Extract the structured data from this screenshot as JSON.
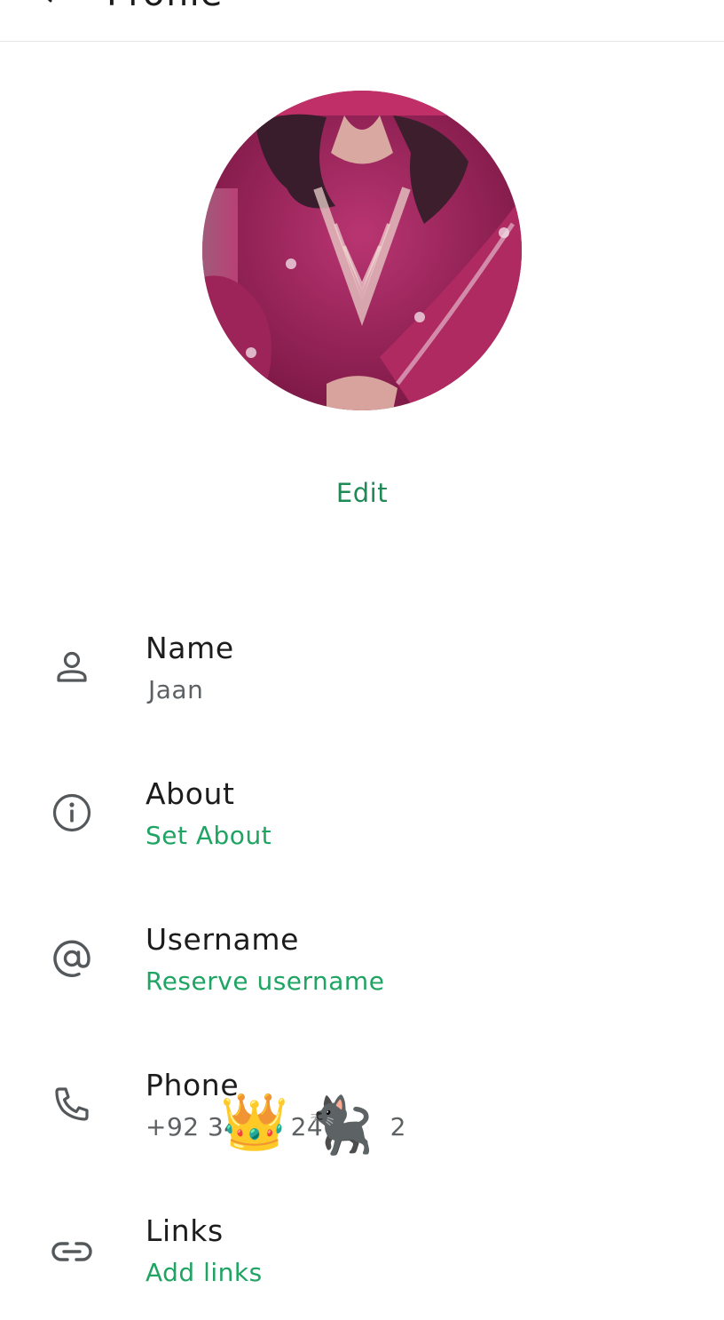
{
  "header": {
    "title": "Profile"
  },
  "profile": {
    "edit_label": "Edit"
  },
  "rows": [
    {
      "label": "Name",
      "value": "Jaan",
      "icon": "person-icon",
      "value_style": "grey"
    },
    {
      "label": "About",
      "value": "Set About",
      "icon": "info-icon",
      "value_style": "green"
    },
    {
      "label": "Username",
      "value": "Reserve username",
      "icon": "at-sign-icon",
      "value_style": "green"
    },
    {
      "label": "Phone",
      "value": "+92 34  240  2",
      "icon": "phone-icon",
      "value_style": "grey"
    },
    {
      "label": "Links",
      "value": "Add links",
      "icon": "link-icon",
      "value_style": "green"
    }
  ],
  "stickers": {
    "crown": "👑",
    "cat": "🐈‍⬛"
  },
  "colors": {
    "accent_green": "#1fa463",
    "edit_green": "#1f8a55",
    "icon_grey": "#54585a",
    "divider": "#e6e6e6"
  }
}
